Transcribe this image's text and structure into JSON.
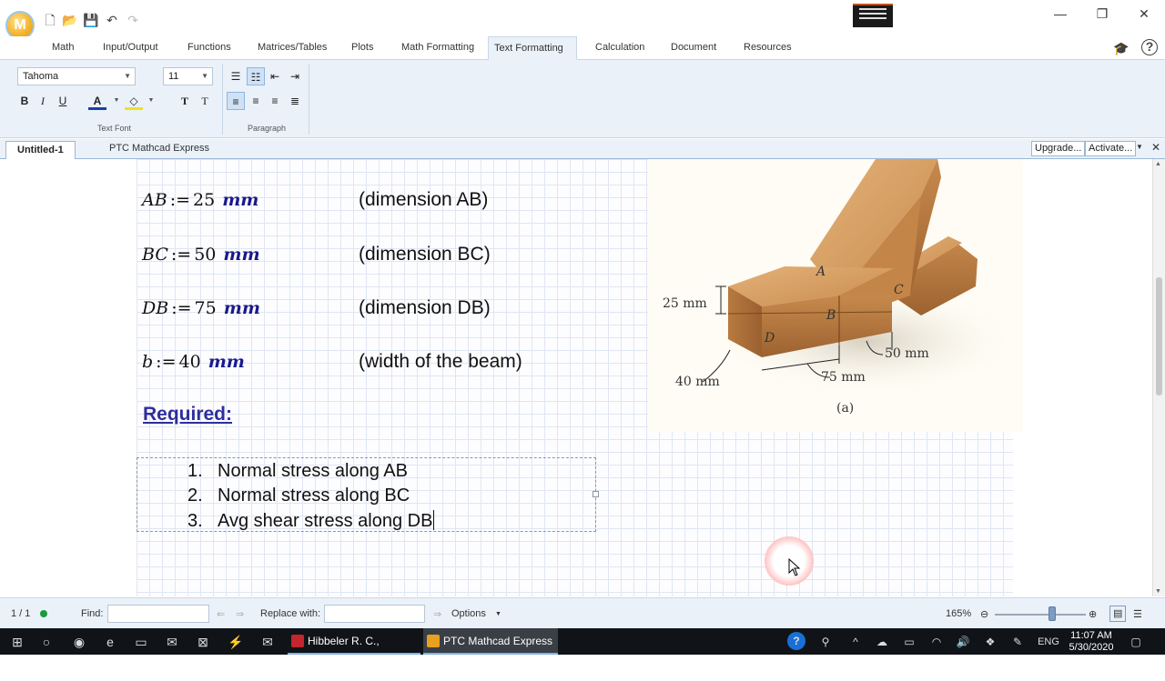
{
  "window": {
    "minimize": "—",
    "restore": "❐",
    "close": "✕"
  },
  "logo_letter": "M",
  "ribbon": {
    "tabs": [
      "Math",
      "Input/Output",
      "Functions",
      "Matrices/Tables",
      "Plots",
      "Math Formatting",
      "Text Formatting",
      "Calculation",
      "Document",
      "Resources"
    ],
    "active_tab": "Text Formatting",
    "font_name": "Tahoma",
    "font_size": "11",
    "bold": "B",
    "italic": "I",
    "underline": "U",
    "group_text_font": "Text Font",
    "group_paragraph": "Paragraph"
  },
  "docbar": {
    "tab_title": "Untitled-1",
    "product": "PTC Mathcad Express",
    "upgrade": "Upgrade...",
    "activate": "Activate..."
  },
  "worksheet": {
    "definitions": [
      {
        "var": "AB",
        "value": "25",
        "unit": "mm",
        "comment": "(dimension AB)"
      },
      {
        "var": "BC",
        "value": "50",
        "unit": "mm",
        "comment": "(dimension BC)"
      },
      {
        "var": "DB",
        "value": "75",
        "unit": "mm",
        "comment": "(dimension DB)"
      },
      {
        "var": "b",
        "value": "40",
        "unit": "mm",
        "comment": "(width of the beam)"
      }
    ],
    "assign_op": ":=",
    "required_heading": "Required:",
    "required_list": [
      {
        "num": "1.",
        "text": "Normal stress along AB"
      },
      {
        "num": "2.",
        "text": "Normal stress along BC"
      },
      {
        "num": "3.",
        "text": "Avg shear stress along DB"
      }
    ]
  },
  "figure": {
    "label_25": "25 mm",
    "label_40": "40 mm",
    "label_75": "75 mm",
    "label_50": "50 mm",
    "point_a": "A",
    "point_b": "B",
    "point_c": "C",
    "point_d": "D",
    "caption": "(a)"
  },
  "status": {
    "page": "1 / 1",
    "find_label": "Find:",
    "replace_label": "Replace with:",
    "options": "Options",
    "zoom": "165%"
  },
  "taskbar": {
    "apps": [
      {
        "label": "Hibbeler R. C., Mecha...",
        "color": "#c4262e"
      },
      {
        "label": "PTC Mathcad Express ...",
        "color": "#e8a020"
      }
    ],
    "lang": "ENG",
    "time": "11:07 AM",
    "date": "5/30/2020"
  }
}
